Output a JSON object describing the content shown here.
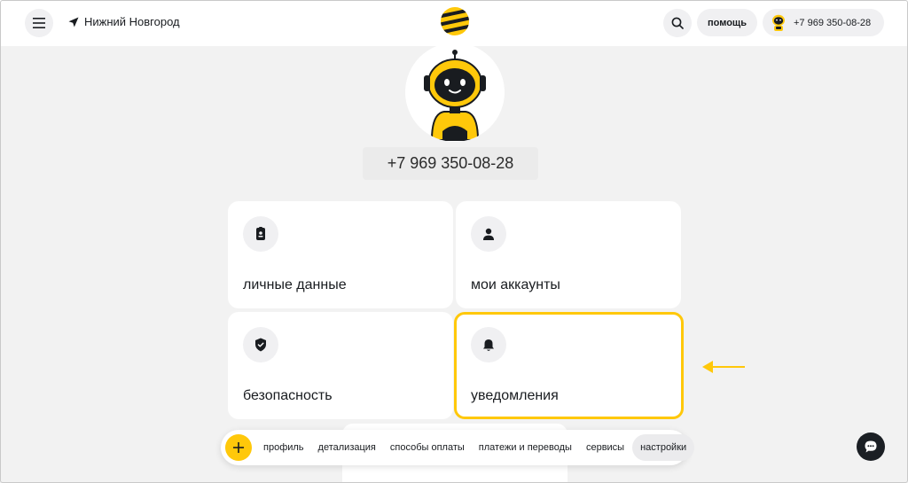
{
  "header": {
    "city": "Нижний Новгород",
    "help_label": "помощь",
    "account_phone": "+7 969 350-08-28"
  },
  "profile": {
    "phone": "+7 969 350-08-28"
  },
  "cards": [
    {
      "label": "личные данные",
      "icon": "id-card-icon"
    },
    {
      "label": "мои аккаунты",
      "icon": "user-icon"
    },
    {
      "label": "безопасность",
      "icon": "shield-icon"
    },
    {
      "label": "уведомления",
      "icon": "bell-icon",
      "selected": true
    }
  ],
  "bottom_nav": {
    "items": [
      {
        "label": "профиль"
      },
      {
        "label": "детализация"
      },
      {
        "label": "способы оплаты"
      },
      {
        "label": "платежи и переводы"
      },
      {
        "label": "сервисы"
      },
      {
        "label": "настройки",
        "active": true
      }
    ]
  },
  "colors": {
    "brand_yellow": "#ffc80a",
    "background": "#f2f2f2",
    "dark": "#191c20"
  }
}
